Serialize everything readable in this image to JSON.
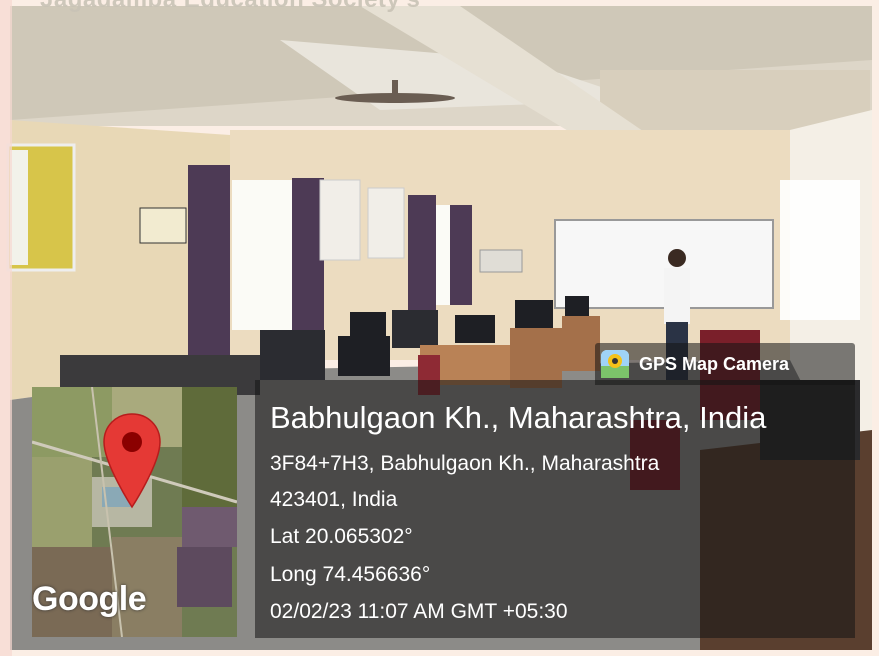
{
  "watermark_top": "Jagadamba Education Society's",
  "badge": {
    "label": "GPS Map Camera",
    "icon": "gps-map-camera-app-icon"
  },
  "map": {
    "brand": "Google",
    "pin_icon": "red-location-pin-icon"
  },
  "location": {
    "title": "Babhulgaon Kh., Maharashtra, India",
    "address_line1": "3F84+7H3, Babhulgaon Kh., Maharashtra",
    "address_line2": "423401, India",
    "lat": "Lat 20.065302°",
    "long": "Long 74.456636°",
    "datetime": "02/02/23 11:07 AM GMT +05:30"
  },
  "colors": {
    "pin": "#e53935",
    "overlay": "#141414",
    "wall": "#efe4cc"
  }
}
